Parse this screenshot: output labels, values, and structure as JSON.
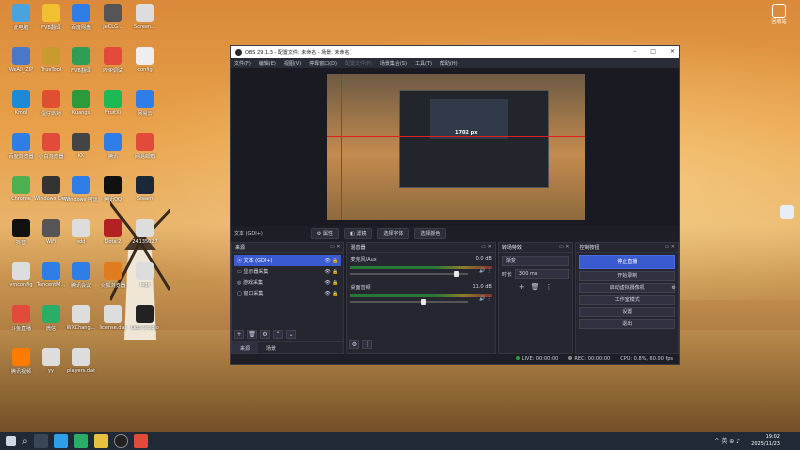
{
  "desktop": {
    "icons": [
      {
        "label": "此电脑",
        "color": "#4aa3df"
      },
      {
        "label": "FVB翻译",
        "color": "#f0c030"
      },
      {
        "label": "百度网盘",
        "color": "#2f7ee8"
      },
      {
        "label": "JeCLG...",
        "color": "#555"
      },
      {
        "label": "Screen...",
        "color": "#ddd"
      },
      {
        "label": "WeAll_ZIP",
        "color": "#4a78c9"
      },
      {
        "label": "TrueTool",
        "color": "#c89a30"
      },
      {
        "label": "FVB翻译",
        "color": "#2f9e55"
      },
      {
        "label": "PHP调试",
        "color": "#e24a3a"
      },
      {
        "label": "config",
        "color": "#eee"
      },
      {
        "label": "Kmol",
        "color": "#1d8ad6"
      },
      {
        "label": "蛋仔派对",
        "color": "#e05030"
      },
      {
        "label": "Kuangs",
        "color": "#2a9a3a"
      },
      {
        "label": "FruitXi",
        "color": "#1db954"
      },
      {
        "label": "网易云",
        "color": "#2f7ee8"
      },
      {
        "label": "百度浏览器",
        "color": "#2f7ee8"
      },
      {
        "label": "小白浏览器",
        "color": "#e24a3a"
      },
      {
        "label": "KK",
        "color": "#444"
      },
      {
        "label": "腾讯",
        "color": "#2f7ee8"
      },
      {
        "label": "网易邮箱",
        "color": "#e24a3a"
      },
      {
        "label": "Chrome",
        "color": "#4caf50"
      },
      {
        "label": "Windows Defender",
        "color": "#333"
      },
      {
        "label": "Windows 可运行",
        "color": "#2f7ee8"
      },
      {
        "label": "腾讯QQ",
        "color": "#111"
      },
      {
        "label": "Steam",
        "color": "#1b2838"
      },
      {
        "label": "抖音",
        "color": "#111"
      },
      {
        "label": "WiFi",
        "color": "#555"
      },
      {
        "label": "sdd",
        "color": "#ddd"
      },
      {
        "label": "Dota 2",
        "color": "#b22222"
      },
      {
        "label": "24135027",
        "color": "#ddd"
      },
      {
        "label": "vmconfig",
        "color": "#ddd"
      },
      {
        "label": "TencentM...",
        "color": "#2f7ee8"
      },
      {
        "label": "腾讯会议",
        "color": "#2f7ee8"
      },
      {
        "label": "火狐浏览器",
        "color": "#e07b20"
      },
      {
        "label": "logs",
        "color": "#ddd"
      },
      {
        "label": "斗鱼直播",
        "color": "#e24a3a"
      },
      {
        "label": "微信",
        "color": "#2aae67"
      },
      {
        "label": "WXChang...",
        "color": "#ddd"
      },
      {
        "label": "license.dat",
        "color": "#ddd"
      },
      {
        "label": "OBS Studio",
        "color": "#222"
      },
      {
        "label": "腾讯视频",
        "color": "#ff7a00"
      },
      {
        "label": "yy",
        "color": "#ddd"
      },
      {
        "label": "players.dat",
        "color": "#ddd"
      }
    ],
    "recycle_bin": "回收站"
  },
  "obs": {
    "title": "OBS 29.1.3 - 配置文件: 未命名 - 场景: 未命名",
    "menu": [
      "文件(F)",
      "编辑(E)",
      "视图(V)",
      "停靠窗口(D)",
      "配置文件(P)",
      "场景集合(S)",
      "工具(T)",
      "帮助(H)"
    ],
    "preview_label": "1702 px",
    "toolbar": {
      "source_name": "文本 (GDI+)",
      "buttons": [
        "属性",
        "滤镜",
        "选择字体",
        "选择颜色"
      ]
    },
    "scenes": {
      "header": "来源",
      "items": [
        {
          "label": "文本 (GDI+)",
          "selected": true
        },
        {
          "label": "显示器采集",
          "selected": false
        },
        {
          "label": "游戏采集",
          "selected": false
        },
        {
          "label": "窗口采集",
          "selected": false
        }
      ],
      "tabs": [
        "来源",
        "场景"
      ]
    },
    "mixer": {
      "header": "混音器",
      "channels": [
        {
          "name": "麦克风/Aux",
          "db": "0.0 dB",
          "level": 0.92
        },
        {
          "name": "桌面音频",
          "db": "11.0 dB",
          "level": 0.62
        }
      ]
    },
    "transitions": {
      "header": "转场特效",
      "selected": "渐变",
      "duration_label": "时长",
      "duration": "300 ms"
    },
    "controls": {
      "header": "控制按钮",
      "buttons": [
        "停止直播",
        "开始录制",
        "启动虚拟摄像机",
        "工作室模式",
        "设置",
        "退出"
      ]
    },
    "status": {
      "live": "LIVE: 00:00:00",
      "rec": "REC: 00:00:00",
      "cpu": "CPU: 0.8%, 60.00 fps"
    }
  },
  "taskbar": {
    "time": "19:02",
    "date": "2025/11/23",
    "tray": "^ 英 ⊕ ♪"
  }
}
